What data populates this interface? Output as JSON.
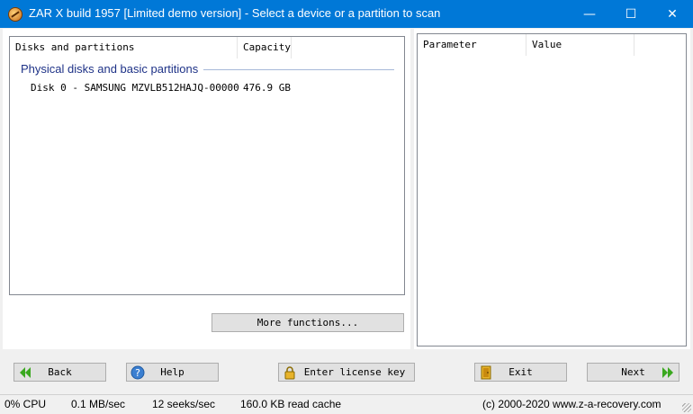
{
  "window": {
    "title": "ZAR X build 1957 [Limited demo version] - Select a device or a partition to scan",
    "minimize": "—",
    "maximize": "☐",
    "close": "✕"
  },
  "disks": {
    "headers": [
      "Disks and partitions",
      "Capacity"
    ],
    "group_label": "Physical disks and basic partitions",
    "rows": [
      {
        "name": "Disk 0 - SAMSUNG MZVLB512HAJQ-00000",
        "capacity": "476.9 GB"
      }
    ]
  },
  "details": {
    "headers": [
      "Parameter",
      "Value"
    ]
  },
  "buttons": {
    "more_functions": "More functions...",
    "back": "Back",
    "help": "Help",
    "license": "Enter license key",
    "exit": "Exit",
    "next": "Next"
  },
  "status": {
    "cpu": "0% CPU",
    "throughput": "0.1 MB/sec",
    "seeks": "12 seeks/sec",
    "cache": "160.0 KB read cache",
    "copyright": "(c) 2000-2020 www.z-a-recovery.com"
  },
  "colors": {
    "titlebar": "#0078d7",
    "group_label": "#1e3287",
    "arrow_green": "#3aa81f"
  }
}
